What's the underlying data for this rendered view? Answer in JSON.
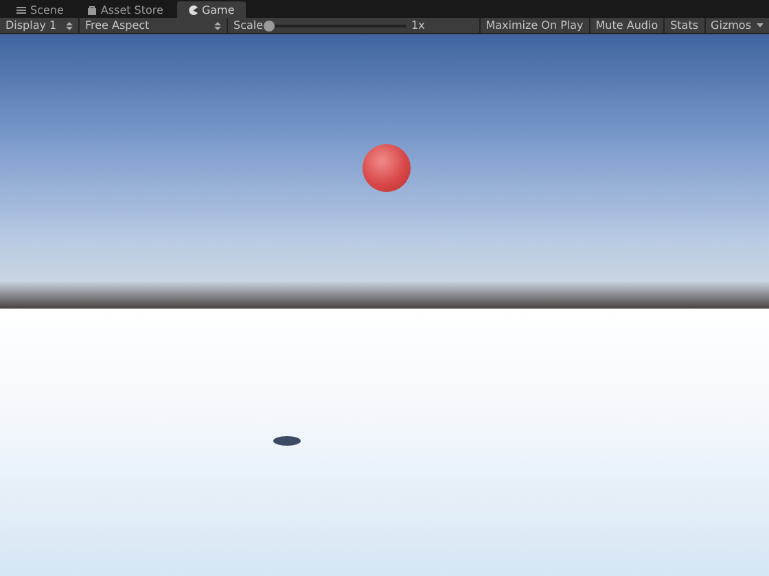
{
  "tabs": [
    {
      "label": "Scene",
      "kind": "scene",
      "selected": false
    },
    {
      "label": "Asset Store",
      "kind": "store",
      "selected": false
    },
    {
      "label": "Game",
      "kind": "game",
      "selected": true
    }
  ],
  "toolbar": {
    "display": "Display 1",
    "aspect": "Free Aspect",
    "scale": {
      "label": "Scale",
      "level": 0,
      "reading": "1x"
    },
    "toggles": [
      {
        "label": "Maximize On Play",
        "on": false
      },
      {
        "label": "Mute Audio",
        "on": false
      },
      {
        "label": "Stats",
        "on": false
      }
    ],
    "gizmos": "Gizmos"
  }
}
